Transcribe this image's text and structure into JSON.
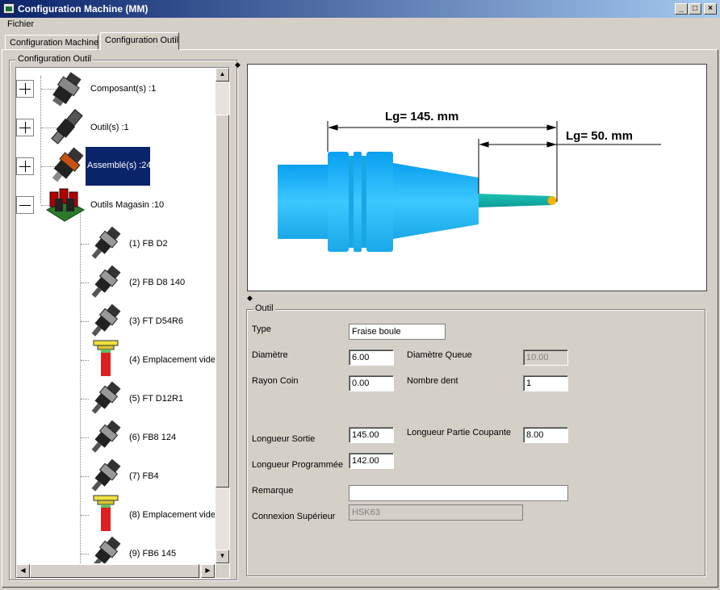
{
  "window": {
    "title": "Configuration Machine (MM)",
    "buttons": {
      "minimize": "_",
      "maximize": "□",
      "close": "×"
    }
  },
  "menu": {
    "items": [
      "Fichier"
    ]
  },
  "tabs": [
    {
      "label": "Configuration Machine",
      "active": false
    },
    {
      "label": "Configuration Outil",
      "active": true
    }
  ],
  "left_panel": {
    "group_title": "Configuration Outil",
    "tree": {
      "roots": [
        {
          "label": "Composant(s) :1",
          "icon": "holder-icon",
          "expander": "+"
        },
        {
          "label": "Outil(s) :1",
          "icon": "cutter-icon",
          "expander": "+"
        },
        {
          "label": "Assemblé(s) :24",
          "icon": "assembly-icon",
          "expander": "+",
          "selected": true
        },
        {
          "label": "Outils Magasin :10",
          "icon": "magazine-icon",
          "expander": "−"
        }
      ],
      "children": [
        {
          "label": "(1) FB D2",
          "icon": "tool-assembly-icon"
        },
        {
          "label": "(2) FB D8 140",
          "icon": "tool-assembly-icon"
        },
        {
          "label": "(3) FT D54R6",
          "icon": "tool-assembly-icon"
        },
        {
          "label": "(4) Emplacement vide",
          "icon": "empty-slot-icon"
        },
        {
          "label": "(5) FT D12R1",
          "icon": "tool-assembly-icon"
        },
        {
          "label": "(6) FB8 124",
          "icon": "tool-assembly-icon"
        },
        {
          "label": "(7) FB4",
          "icon": "tool-assembly-icon"
        },
        {
          "label": "(8) Emplacement vide",
          "icon": "empty-slot-icon"
        },
        {
          "label": "(9) FB6 145",
          "icon": "tool-assembly-icon"
        }
      ]
    }
  },
  "preview": {
    "dim_total": "Lg=  145. mm",
    "dim_cutting": "Lg=  50. mm",
    "colors": {
      "holder": "#19b8f0",
      "tool": "#20c8b8",
      "tip": "#f5b400"
    }
  },
  "outil": {
    "group_title": "Outil",
    "type_label": "Type",
    "type_value": "Fraise boule",
    "diametre_label": "Diamètre",
    "diametre_value": "6.00",
    "diametre_queue_label": "Diamètre Queue",
    "diametre_queue_value": "10.00",
    "rayon_coin_label": "Rayon Coin",
    "rayon_coin_value": "0.00",
    "nombre_dent_label": "Nombre dent",
    "nombre_dent_value": "1",
    "longueur_sortie_label": "Longueur Sortie",
    "longueur_sortie_value": "145.00",
    "longueur_partie_coupante_label": "Longueur Partie Coupante",
    "longueur_partie_coupante_value": "8.00",
    "longueur_programmee_label": "Longueur Programmée",
    "longueur_programmee_value": "142.00",
    "remarque_label": "Remarque",
    "remarque_value": "",
    "connexion_label": "Connexion Supérieur",
    "connexion_value": "HSK63"
  }
}
